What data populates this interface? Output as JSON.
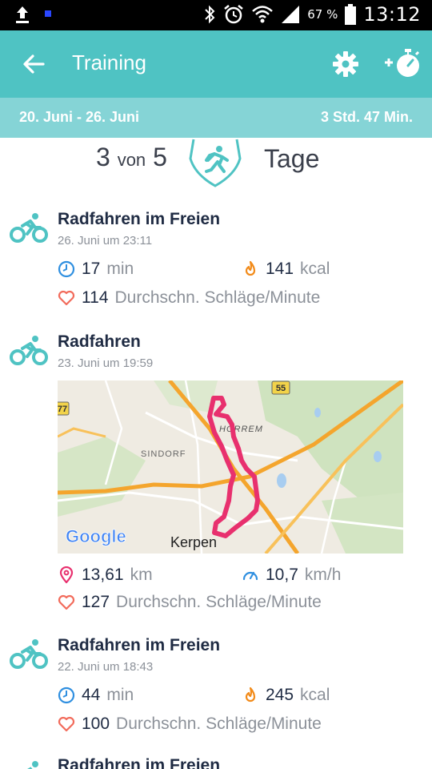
{
  "statusbar": {
    "battery_percent": "67 %",
    "time": "13:12"
  },
  "appbar": {
    "title": "Training",
    "back_icon": "arrow-back-icon",
    "settings_icon": "gear-icon",
    "add_icon": "add-stopwatch-icon"
  },
  "summary": {
    "date_range": "20. Juni - 26. Juni",
    "total_duration": "3 Std. 47 Min."
  },
  "goal": {
    "achieved": "3",
    "separator": "von",
    "target": "5",
    "unit": "Tage"
  },
  "activities": [
    {
      "name": "Radfahren im Freien",
      "date": "26. Juni um 23:11",
      "duration_value": "17",
      "duration_unit": "min",
      "calories_value": "141",
      "calories_unit": "kcal",
      "heart_value": "114",
      "heart_label": "Durchschn. Schläge/Minute"
    },
    {
      "name": "Radfahren",
      "date": "23. Juni um 19:59",
      "map": {
        "road_label_55": "55",
        "road_label_77": "77",
        "place_horrem": "HORREM",
        "place_sindorf": "SINDORF",
        "place_kerpen": "Kerpen",
        "logo": "Google"
      },
      "distance_value": "13,61",
      "distance_unit": "km",
      "speed_value": "10,7",
      "speed_unit": "km/h",
      "heart_value": "127",
      "heart_label": "Durchschn. Schläge/Minute"
    },
    {
      "name": "Radfahren im Freien",
      "date": "22. Juni um 18:43",
      "duration_value": "44",
      "duration_unit": "min",
      "calories_value": "245",
      "calories_unit": "kcal",
      "heart_value": "100",
      "heart_label": "Durchschn. Schläge/Minute"
    },
    {
      "name": "Radfahren im Freien"
    }
  ],
  "colors": {
    "primary": "#4fc3c3",
    "subbar": "#85d4d6",
    "route": "#e8306e",
    "clock": "#2f8fe0",
    "flame": "#f28b1a",
    "heart": "#f26b5b"
  }
}
